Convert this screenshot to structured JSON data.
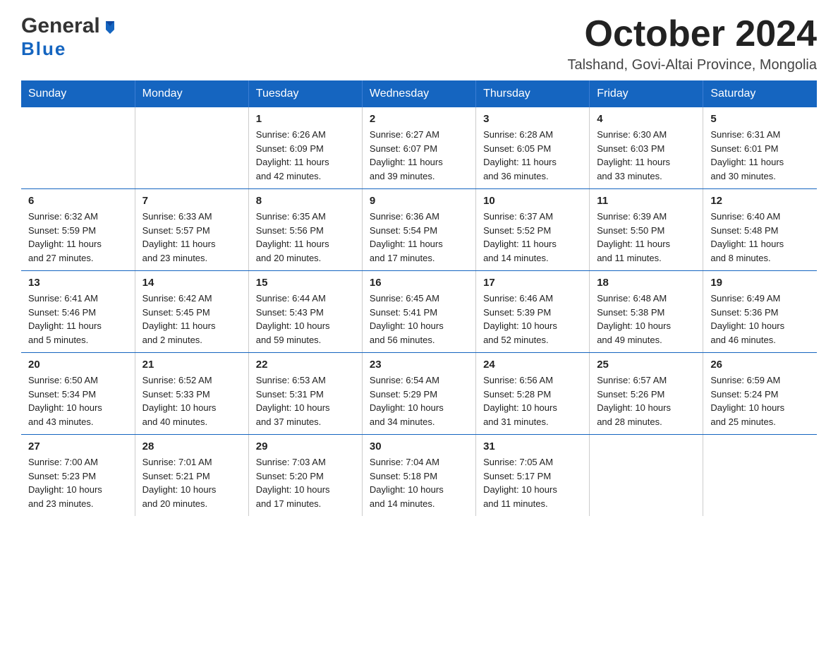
{
  "header": {
    "logo_line1": "General",
    "logo_line2": "Blue",
    "month": "October 2024",
    "location": "Talshand, Govi-Altai Province, Mongolia"
  },
  "days_of_week": [
    "Sunday",
    "Monday",
    "Tuesday",
    "Wednesday",
    "Thursday",
    "Friday",
    "Saturday"
  ],
  "weeks": [
    [
      {
        "day": "",
        "info": ""
      },
      {
        "day": "",
        "info": ""
      },
      {
        "day": "1",
        "info": "Sunrise: 6:26 AM\nSunset: 6:09 PM\nDaylight: 11 hours\nand 42 minutes."
      },
      {
        "day": "2",
        "info": "Sunrise: 6:27 AM\nSunset: 6:07 PM\nDaylight: 11 hours\nand 39 minutes."
      },
      {
        "day": "3",
        "info": "Sunrise: 6:28 AM\nSunset: 6:05 PM\nDaylight: 11 hours\nand 36 minutes."
      },
      {
        "day": "4",
        "info": "Sunrise: 6:30 AM\nSunset: 6:03 PM\nDaylight: 11 hours\nand 33 minutes."
      },
      {
        "day": "5",
        "info": "Sunrise: 6:31 AM\nSunset: 6:01 PM\nDaylight: 11 hours\nand 30 minutes."
      }
    ],
    [
      {
        "day": "6",
        "info": "Sunrise: 6:32 AM\nSunset: 5:59 PM\nDaylight: 11 hours\nand 27 minutes."
      },
      {
        "day": "7",
        "info": "Sunrise: 6:33 AM\nSunset: 5:57 PM\nDaylight: 11 hours\nand 23 minutes."
      },
      {
        "day": "8",
        "info": "Sunrise: 6:35 AM\nSunset: 5:56 PM\nDaylight: 11 hours\nand 20 minutes."
      },
      {
        "day": "9",
        "info": "Sunrise: 6:36 AM\nSunset: 5:54 PM\nDaylight: 11 hours\nand 17 minutes."
      },
      {
        "day": "10",
        "info": "Sunrise: 6:37 AM\nSunset: 5:52 PM\nDaylight: 11 hours\nand 14 minutes."
      },
      {
        "day": "11",
        "info": "Sunrise: 6:39 AM\nSunset: 5:50 PM\nDaylight: 11 hours\nand 11 minutes."
      },
      {
        "day": "12",
        "info": "Sunrise: 6:40 AM\nSunset: 5:48 PM\nDaylight: 11 hours\nand 8 minutes."
      }
    ],
    [
      {
        "day": "13",
        "info": "Sunrise: 6:41 AM\nSunset: 5:46 PM\nDaylight: 11 hours\nand 5 minutes."
      },
      {
        "day": "14",
        "info": "Sunrise: 6:42 AM\nSunset: 5:45 PM\nDaylight: 11 hours\nand 2 minutes."
      },
      {
        "day": "15",
        "info": "Sunrise: 6:44 AM\nSunset: 5:43 PM\nDaylight: 10 hours\nand 59 minutes."
      },
      {
        "day": "16",
        "info": "Sunrise: 6:45 AM\nSunset: 5:41 PM\nDaylight: 10 hours\nand 56 minutes."
      },
      {
        "day": "17",
        "info": "Sunrise: 6:46 AM\nSunset: 5:39 PM\nDaylight: 10 hours\nand 52 minutes."
      },
      {
        "day": "18",
        "info": "Sunrise: 6:48 AM\nSunset: 5:38 PM\nDaylight: 10 hours\nand 49 minutes."
      },
      {
        "day": "19",
        "info": "Sunrise: 6:49 AM\nSunset: 5:36 PM\nDaylight: 10 hours\nand 46 minutes."
      }
    ],
    [
      {
        "day": "20",
        "info": "Sunrise: 6:50 AM\nSunset: 5:34 PM\nDaylight: 10 hours\nand 43 minutes."
      },
      {
        "day": "21",
        "info": "Sunrise: 6:52 AM\nSunset: 5:33 PM\nDaylight: 10 hours\nand 40 minutes."
      },
      {
        "day": "22",
        "info": "Sunrise: 6:53 AM\nSunset: 5:31 PM\nDaylight: 10 hours\nand 37 minutes."
      },
      {
        "day": "23",
        "info": "Sunrise: 6:54 AM\nSunset: 5:29 PM\nDaylight: 10 hours\nand 34 minutes."
      },
      {
        "day": "24",
        "info": "Sunrise: 6:56 AM\nSunset: 5:28 PM\nDaylight: 10 hours\nand 31 minutes."
      },
      {
        "day": "25",
        "info": "Sunrise: 6:57 AM\nSunset: 5:26 PM\nDaylight: 10 hours\nand 28 minutes."
      },
      {
        "day": "26",
        "info": "Sunrise: 6:59 AM\nSunset: 5:24 PM\nDaylight: 10 hours\nand 25 minutes."
      }
    ],
    [
      {
        "day": "27",
        "info": "Sunrise: 7:00 AM\nSunset: 5:23 PM\nDaylight: 10 hours\nand 23 minutes."
      },
      {
        "day": "28",
        "info": "Sunrise: 7:01 AM\nSunset: 5:21 PM\nDaylight: 10 hours\nand 20 minutes."
      },
      {
        "day": "29",
        "info": "Sunrise: 7:03 AM\nSunset: 5:20 PM\nDaylight: 10 hours\nand 17 minutes."
      },
      {
        "day": "30",
        "info": "Sunrise: 7:04 AM\nSunset: 5:18 PM\nDaylight: 10 hours\nand 14 minutes."
      },
      {
        "day": "31",
        "info": "Sunrise: 7:05 AM\nSunset: 5:17 PM\nDaylight: 10 hours\nand 11 minutes."
      },
      {
        "day": "",
        "info": ""
      },
      {
        "day": "",
        "info": ""
      }
    ]
  ]
}
